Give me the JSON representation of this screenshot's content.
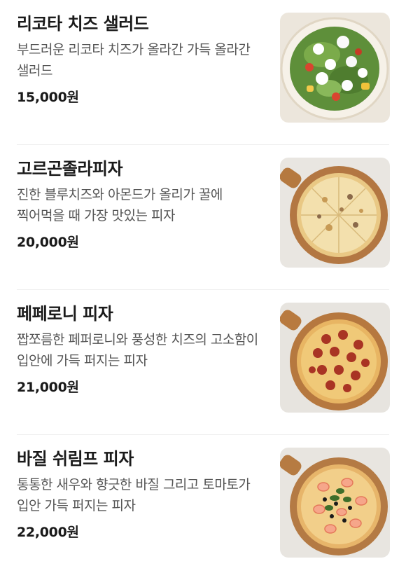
{
  "menu": {
    "items": [
      {
        "name": "리코타 치즈 샐러드",
        "description": "부드러운 리코타 치즈가 올라간 가득 올라간 샐러드",
        "price": "15,000원",
        "image_icon": "ricotta-salad-photo"
      },
      {
        "name": "고르곤졸라피자",
        "description": "진한 블루치즈와 아몬드가 올리가 꿀에 찍어먹을 때 가장 맛있는 피자",
        "price": "20,000원",
        "image_icon": "gorgonzola-pizza-photo"
      },
      {
        "name": "페페로니 피자",
        "description": "짭쪼름한 페퍼로니와 풍성한 치즈의 고소함이 입안에 가득 퍼지는 피자",
        "price": "21,000원",
        "image_icon": "pepperoni-pizza-photo"
      },
      {
        "name": "바질 쉬림프 피자",
        "description": "통통한 새우와 향긋한 바질 그리고 토마토가 입안 가득 퍼지는 피자",
        "price": "22,000원",
        "image_icon": "basil-shrimp-pizza-photo"
      }
    ]
  }
}
